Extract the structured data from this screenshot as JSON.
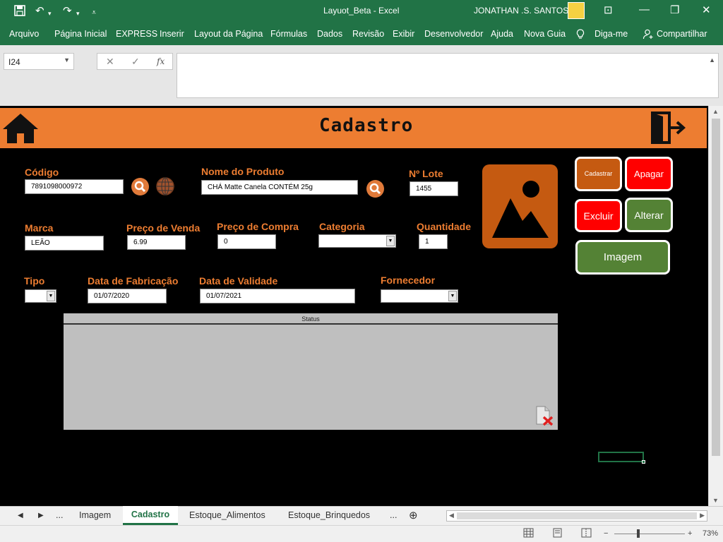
{
  "titlebar": {
    "title": "Layuot_Beta  -  Excel",
    "user": "JONATHAN .S. SANTOS",
    "save_icon": "floppy-icon",
    "undo_icon": "undo-icon",
    "redo_icon": "redo-icon"
  },
  "menu": {
    "items": [
      "Arquivo",
      "Página Inicial",
      "EXPRESS",
      "Inserir",
      "Layout da Página",
      "Fórmulas",
      "Dados",
      "Revisão",
      "Exibir",
      "Desenvolvedor",
      "Ajuda",
      "Nova Guia",
      "Diga-me",
      "Compartilhar"
    ]
  },
  "formula_bar": {
    "name_box": "I24",
    "fx_label": "fx",
    "formula_value": ""
  },
  "form": {
    "title": "Cadastro",
    "labels": {
      "codigo": "Código",
      "nome_produto": "Nome do Produto",
      "lote": "Nº Lote",
      "marca": "Marca",
      "preco_venda": "Preço de Venda",
      "preco_compra": "Preço de Compra",
      "categoria": "Categoria",
      "quantidade": "Quantidade",
      "tipo": "Tipo",
      "data_fabricacao": "Data de Fabricação",
      "data_validade": "Data de Validade",
      "fornecedor": "Fornecedor"
    },
    "values": {
      "codigo": "7891098000972",
      "nome_produto": "CHÁ Matte Canela CONTÉM 25g",
      "lote": "1455",
      "marca": "LEÃO",
      "preco_venda": "6.99",
      "preco_compra": "0",
      "categoria": "",
      "quantidade": "1",
      "tipo": "",
      "data_fabricacao": "01/07/2020",
      "data_validade": "01/07/2021",
      "fornecedor": ""
    },
    "buttons": {
      "cadastrar": "Cadastrar",
      "apagar": "Apagar",
      "excluir": "Excluir",
      "alterar": "Alterar",
      "imagem": "Imagem"
    },
    "status_header": "Status",
    "colors": {
      "accent": "#ed7d31",
      "green_button": "#548235",
      "red_button": "#ff0000",
      "brown_button": "#c55a11"
    }
  },
  "sheet_tabs": {
    "more_left": "...",
    "tabs": [
      "Imagem",
      "Cadastro",
      "Estoque_Alimentos",
      "Estoque_Brinquedos"
    ],
    "active": "Cadastro",
    "more_right": "..."
  },
  "statusbar": {
    "zoom": "73%",
    "zoom_out": "−",
    "zoom_in": "+"
  }
}
